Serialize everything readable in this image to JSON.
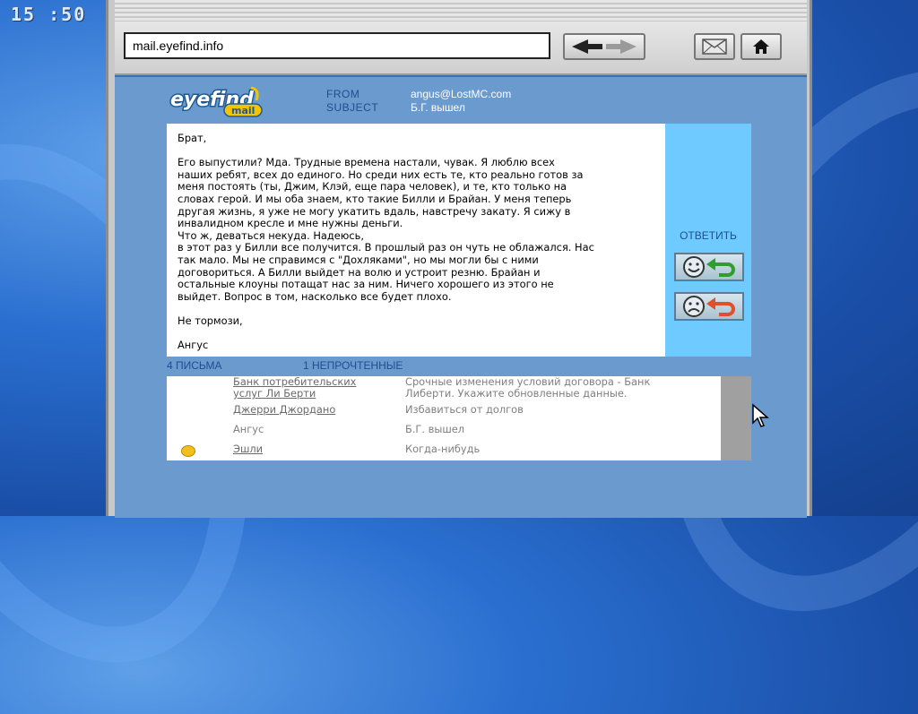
{
  "clock": {
    "time": "15 :50"
  },
  "browser": {
    "url": "mail.eyefind.info",
    "icons": {
      "nav": "back-forward-arrows-icon",
      "mail": "envelope-icon",
      "home": "home-icon"
    }
  },
  "email": {
    "logo": {
      "line1": "eyefind",
      "line2": "mail"
    },
    "from_label": "FROM",
    "from_value": "angus@LostMC.com",
    "subject_label": "SUBJECT",
    "subject_value": "Б.Г. вышел",
    "body": {
      "greeting": "Брат,",
      "paragraph1": "Его выпустили? Мда. Трудные времена настали, чувак. Я люблю всех\nнаших ребят, всех до единого. Но среди них есть те, кто реально готов за\nменя постоять (ты, Джим, Клэй, еще пара человек), и те, кто только на\nсловах герой. И мы оба знаем, кто такие Билли и Брайан. У меня теперь\nдругая жизнь, я уже не могу укатить вдаль, навстречу закату. Я сижу в\nинвалидном кресле и мне нужны деньги.\n Что ж, деваться некуда. Надеюсь,\nв этот раз у Билли все получится. В прошлый раз он чуть не облажался. Нас\nтак мало. Мы не справимся с \"Дохляками\", но мы могли бы с ними\nдоговориться. А Билли выйдет на волю и устроит резню. Брайан и\nостальные клоуны потащат нас за ним. Ничего хорошего из этого не\nвыйдет. Вопрос в том, насколько все будет плохо.",
      "closing": "Не тормози,",
      "signature": "Ангус"
    }
  },
  "reply": {
    "label": "ОТВЕТИТЬ",
    "positive_icon": "happy-face-reply-icon",
    "negative_icon": "sad-face-reply-icon"
  },
  "inbox": {
    "count_label": "4 ПИСЬМА",
    "unread_label": "1 НЕПРОЧТЕННЫЕ",
    "rows": [
      {
        "sender": "Банк потребительских\nуслуг Ли Берти",
        "subject": "Срочные изменения условий договора - Банк\nЛиберти. Укажите обновленные данные.",
        "unread": false
      },
      {
        "sender": "Джерри Джордано",
        "subject": "Избавиться от долгов",
        "unread": false
      },
      {
        "sender": "Ангус",
        "subject": "Б.Г. вышел",
        "unread": false
      },
      {
        "sender": "Эшли",
        "subject": "Когда-нибудь",
        "unread": true
      }
    ]
  },
  "colors": {
    "window_bg": "#6b9acf",
    "reply_panel": "#6fcbff",
    "label_blue": "#1e4f8c",
    "unread_dot": "#f3bf1c"
  }
}
